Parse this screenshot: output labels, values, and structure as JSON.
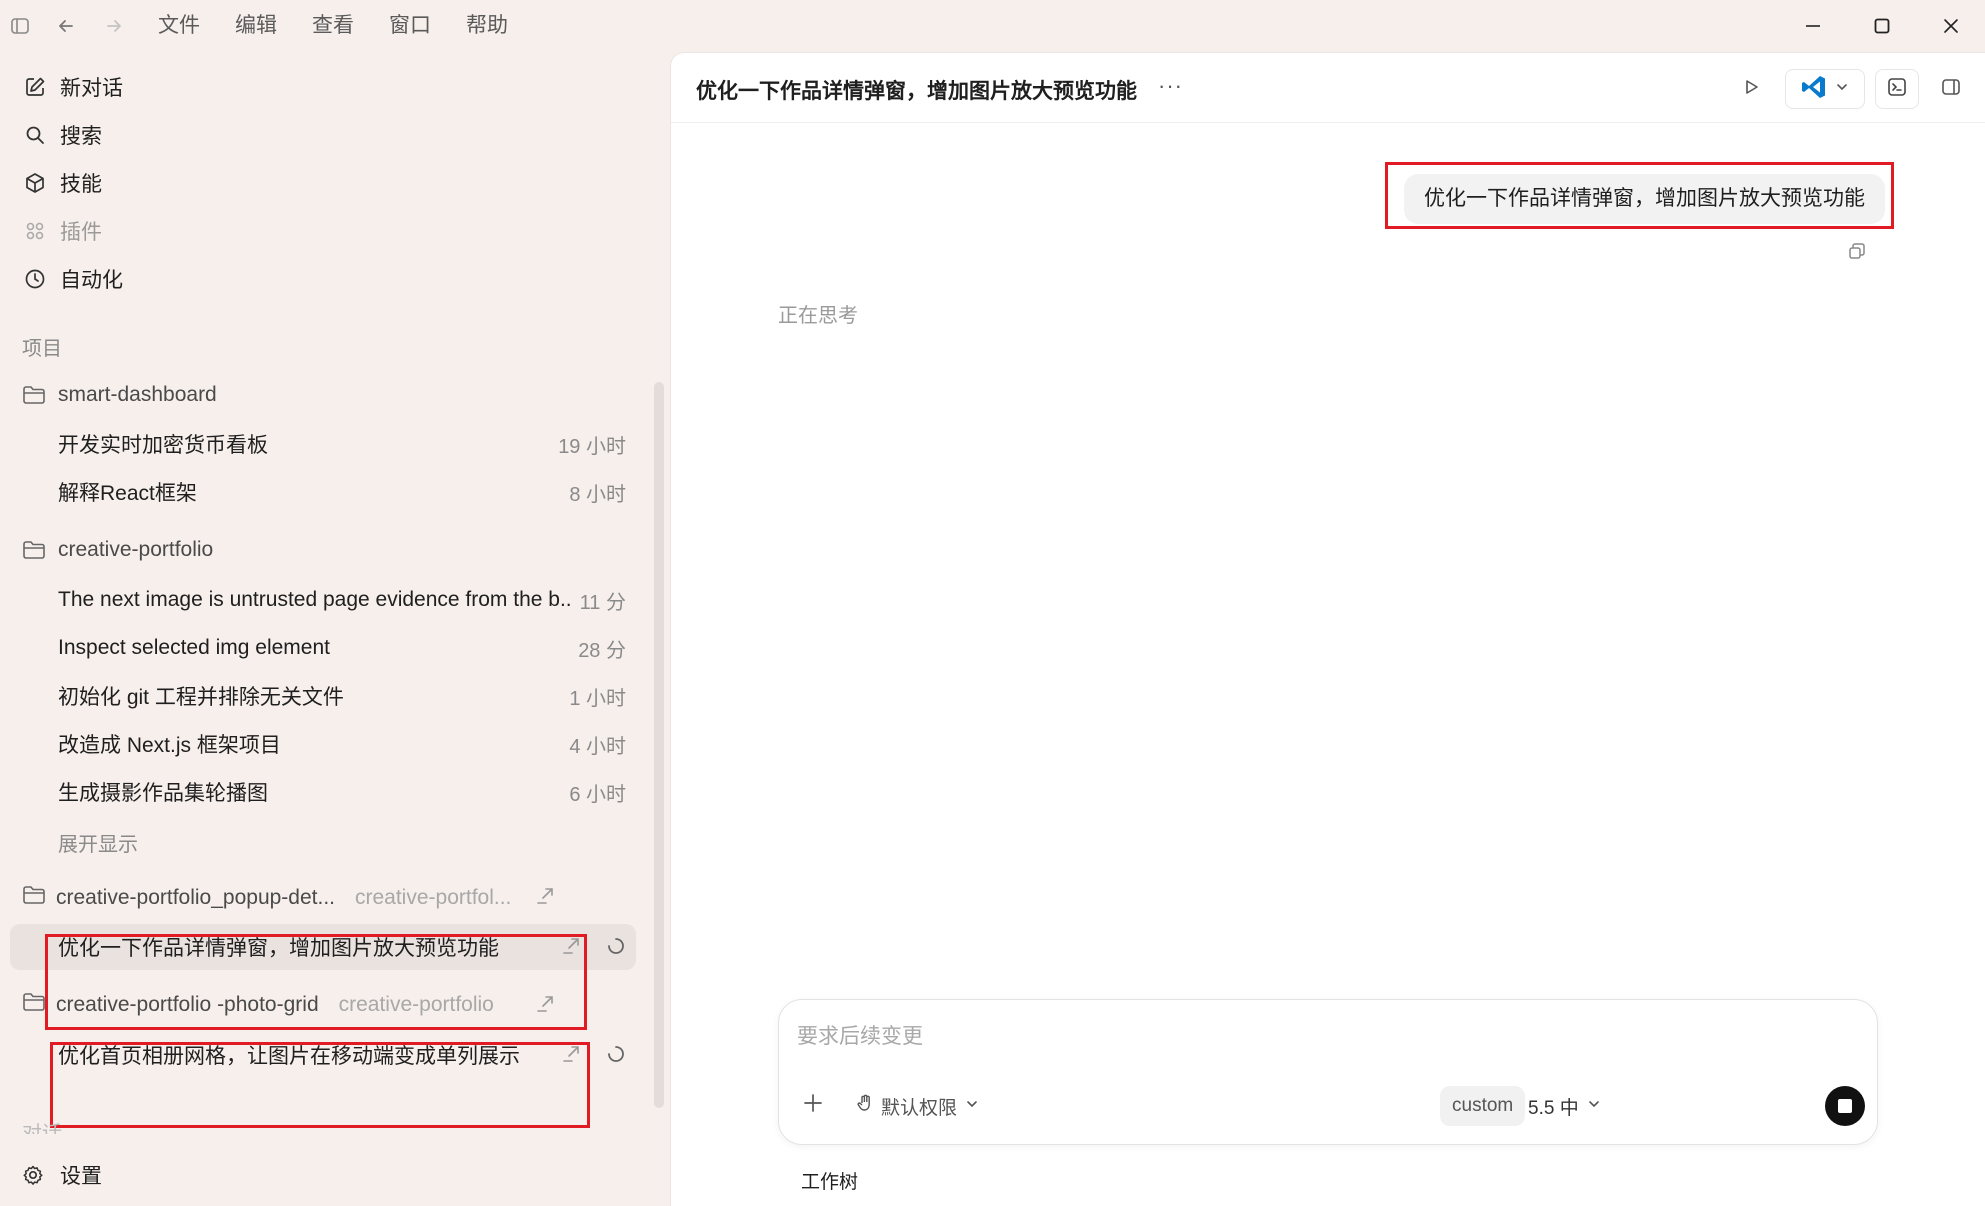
{
  "menu": [
    "文件",
    "编辑",
    "查看",
    "窗口",
    "帮助"
  ],
  "sidebar": {
    "nav": [
      {
        "label": "新对话",
        "icon": "edit-icon"
      },
      {
        "label": "搜索",
        "icon": "search-icon"
      },
      {
        "label": "技能",
        "icon": "cube-icon"
      },
      {
        "label": "插件",
        "icon": "grid-icon"
      },
      {
        "label": "自动化",
        "icon": "clock-icon"
      }
    ],
    "section_label": "项目",
    "projects": [
      {
        "name": "smart-dashboard",
        "threads": [
          {
            "title": "开发实时加密货币看板",
            "time": "19 小时"
          },
          {
            "title": "解释React框架",
            "time": "8 小时"
          }
        ]
      },
      {
        "name": "creative-portfolio",
        "threads": [
          {
            "title": "The next image is untrusted page evidence from the b...",
            "time": "11 分"
          },
          {
            "title": "Inspect selected img element",
            "time": "28 分"
          },
          {
            "title": "初始化 git 工程并排除无关文件",
            "time": "1 小时"
          },
          {
            "title": "改造成 Next.js 框架项目",
            "time": "4 小时"
          },
          {
            "title": "生成摄影作品集轮播图",
            "time": "6 小时"
          }
        ],
        "expand_label": "展开显示"
      }
    ],
    "worktrees": [
      {
        "name": "creative-portfolio_popup-det...",
        "sub": "creative-portfol...",
        "thread": "优化一下作品详情弹窗，增加图片放大预览功能"
      },
      {
        "name": "creative-portfolio -photo-grid",
        "sub": "creative-portfolio",
        "thread": "优化首页相册网格，让图片在移动端变成单列展示"
      }
    ],
    "conversations_label": "对话",
    "settings_label": "设置"
  },
  "main": {
    "title": "优化一下作品详情弹窗，增加图片放大预览功能",
    "more": "···",
    "user_message": "优化一下作品详情弹窗，增加图片放大预览功能",
    "thinking": "正在思考",
    "composer": {
      "placeholder": "要求后续变更",
      "permission": "默认权限",
      "model_tag": "custom",
      "model_version": "5.5 中"
    },
    "worktree_label": "工作树"
  },
  "colors": {
    "accent_red": "#e01b24",
    "vscode_blue": "#0a7acc"
  }
}
